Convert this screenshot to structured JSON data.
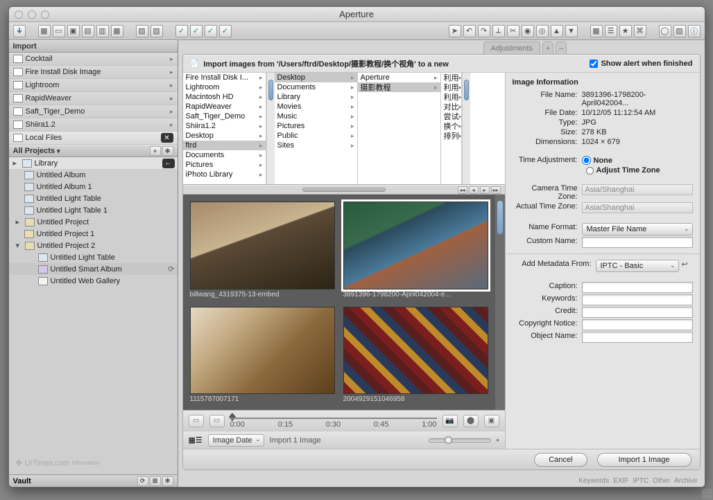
{
  "window": {
    "title": "Aperture"
  },
  "sidebar": {
    "import_header": "Import",
    "sources": [
      "Cocktail",
      "Fire Install Disk Image",
      "Lightroom",
      "RapidWeaver",
      "Saft_Tiger_Demo",
      "Shiira1.2",
      "Local Files"
    ],
    "projects_header": "All Projects",
    "tree": {
      "library": "Library",
      "items": [
        "Untitled Album",
        "Untitled Album 1",
        "Untitled Light Table",
        "Untitled Light Table 1"
      ],
      "proj": "Untitled Project",
      "proj1": "Untitled Project 1",
      "proj2": "Untitled Project 2",
      "sub": {
        "lt": "Untitled Light Table",
        "sa": "Untitled Smart Album",
        "wg": "Untitled Web Gallery"
      }
    },
    "vault": "Vault",
    "watermark": "UITimes.com",
    "watermark_sub": "information"
  },
  "sheet": {
    "tab_adjust": "Adjustments",
    "icon": "📄",
    "prompt_pre": "Import images from '",
    "prompt_path": "/Users/ftrd/Desktop/摄影教程/换个视角",
    "prompt_post": "' to a new",
    "alert": "Show alert when finished",
    "col1": [
      "Fire Install Disk I...",
      "Lightroom",
      "Macintosh HD",
      "RapidWeaver",
      "Saft_Tiger_Demo",
      "Shiira1.2",
      "Desktop",
      "ftrd",
      "Documents",
      "Pictures",
      "iPhoto Library"
    ],
    "col1_sel": 7,
    "col2": [
      "Desktop",
      "Documents",
      "Library",
      "Movies",
      "Music",
      "Pictures",
      "Public",
      "Sites"
    ],
    "col2_sel": 0,
    "col3": [
      "Aperture",
      "摄影教程"
    ],
    "col3_sel": 1,
    "col4": [
      "利用",
      "利用",
      "利用",
      "对比",
      "尝试",
      "换个",
      "排列"
    ],
    "thumbs": [
      {
        "cap": "billwang_4319375-13-embed"
      },
      {
        "cap": "3891396-1798200-April042004-e..."
      },
      {
        "cap": "1115787007171"
      },
      {
        "cap": "2004929151046958"
      }
    ],
    "timeline_ticks": [
      "0:00",
      "0:15",
      "0:30",
      "0:45",
      "1:00"
    ],
    "sort_popup": "Image Date",
    "count_label": "Import 1 Image"
  },
  "meta": {
    "header": "Image Information",
    "filename_k": "File Name:",
    "filename_v": "3891396-1798200-April042004...",
    "filedate_k": "File Date:",
    "filedate_v": "10/12/05  11:12:54 AM",
    "type_k": "Type:",
    "type_v": "JPG",
    "size_k": "Size:",
    "size_v": "278 KB",
    "dim_k": "Dimensions:",
    "dim_v": "1024 × 679",
    "timeadj_k": "Time Adjustment:",
    "timeadj_none": "None",
    "timeadj_adjust": "Adjust Time Zone",
    "cam_tz_k": "Camera Time Zone:",
    "cam_tz_v": "Asia/Shanghai",
    "act_tz_k": "Actual Time Zone:",
    "act_tz_v": "Asia/Shanghai",
    "nameformat_k": "Name Format:",
    "nameformat_v": "Master File Name",
    "customname_k": "Custom Name:",
    "addmeta_k": "Add Metadata From:",
    "addmeta_v": "IPTC - Basic",
    "caption_k": "Caption:",
    "keywords_k": "Keywords:",
    "credit_k": "Credit:",
    "copyright_k": "Copyright Notice:",
    "objname_k": "Object Name:"
  },
  "foot": {
    "cancel": "Cancel",
    "import": "Import 1 Image"
  },
  "bottom_tabs": [
    "Keywords",
    "EXIF",
    "IPTC",
    "Other",
    "Archive"
  ]
}
